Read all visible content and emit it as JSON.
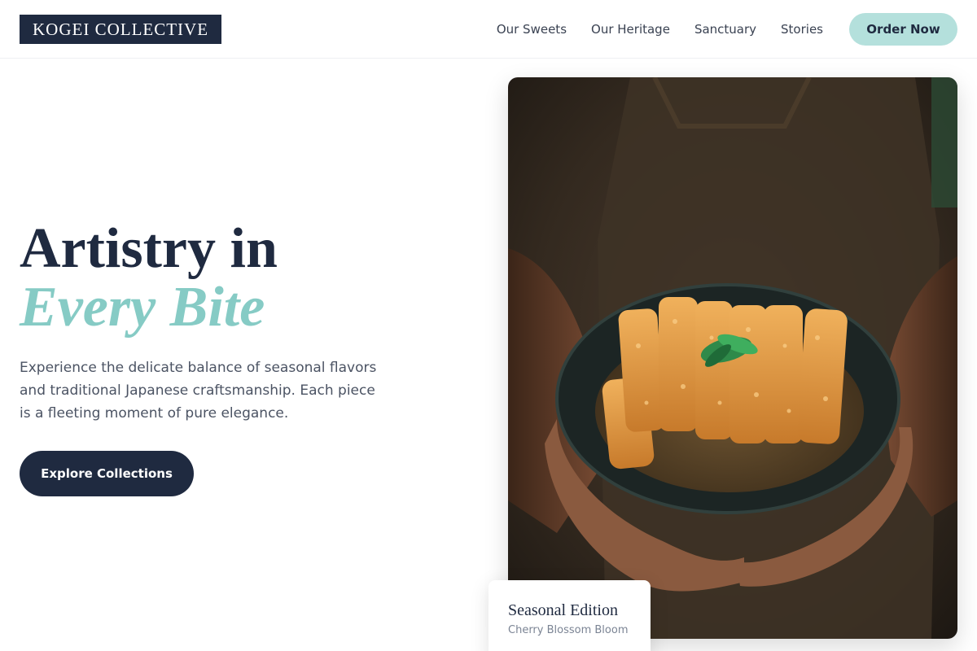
{
  "brand": {
    "name": "KOGEI COLLECTIVE"
  },
  "nav": {
    "links": [
      "Our Sweets",
      "Our Heritage",
      "Sanctuary",
      "Stories"
    ],
    "cta_label": "Order Now"
  },
  "hero": {
    "title_line1": "Artistry in",
    "title_line2": "Every Bite",
    "description": "Experience the delicate balance of seasonal flavors and traditional Japanese craftsmanship. Each piece is a fleeting moment of pure elegance.",
    "button_label": "Explore Collections",
    "image_subject": "Hands holding a dark bowl of breaded cutlet slices in sauce topped with green herbs, against a brown apron"
  },
  "card": {
    "title": "Seasonal Edition",
    "subtitle": "Cherry Blossom Bloom"
  },
  "colors": {
    "navy": "#1f2a40",
    "mint": "#b4e0dc",
    "accent_teal": "#86cbc5",
    "body_text": "#4b5363"
  }
}
